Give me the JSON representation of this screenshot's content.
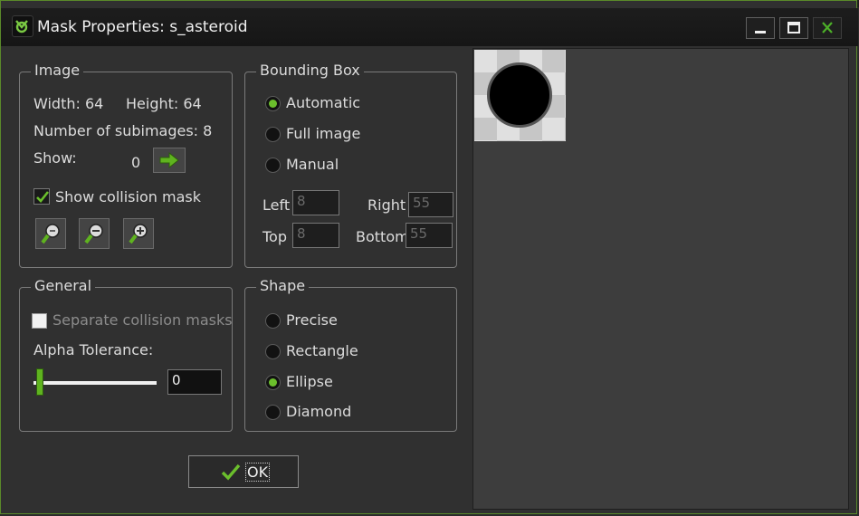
{
  "window": {
    "title": "Mask Properties: s_asteroid",
    "controls": {
      "minimize_icon": "minimize-icon",
      "maximize_icon": "maximize-icon",
      "close_icon": "close-icon"
    }
  },
  "image_group": {
    "legend": "Image",
    "width_text": "Width: 64",
    "height_text": "Height: 64",
    "subimages_text": "Number of subimages: 8",
    "show_label": "Show:",
    "show_value": "0",
    "show_collision_label": "Show collision mask",
    "show_collision_checked": true,
    "zoom_buttons": [
      "zoom-reset-icon",
      "zoom-out-icon",
      "zoom-in-icon"
    ]
  },
  "bounding_box": {
    "legend": "Bounding Box",
    "options": [
      {
        "label": "Automatic",
        "selected": true
      },
      {
        "label": "Full image",
        "selected": false
      },
      {
        "label": "Manual",
        "selected": false
      }
    ],
    "left_label": "Left",
    "left_value": "8",
    "right_label": "Right",
    "right_value": "55",
    "top_label": "Top",
    "top_value": "8",
    "bottom_label": "Bottom",
    "bottom_value": "55"
  },
  "general": {
    "legend": "General",
    "separate_label": "Separate collision masks",
    "separate_checked": false,
    "alpha_label": "Alpha Tolerance:",
    "alpha_value": "0"
  },
  "shape": {
    "legend": "Shape",
    "options": [
      {
        "label": "Precise",
        "selected": false
      },
      {
        "label": "Rectangle",
        "selected": false
      },
      {
        "label": "Ellipse",
        "selected": true
      },
      {
        "label": "Diamond",
        "selected": false
      }
    ]
  },
  "ok_label": "OK",
  "colors": {
    "accent_green": "#6bbf2c",
    "background": "#303030",
    "preview_background": "#3d3d3d"
  }
}
